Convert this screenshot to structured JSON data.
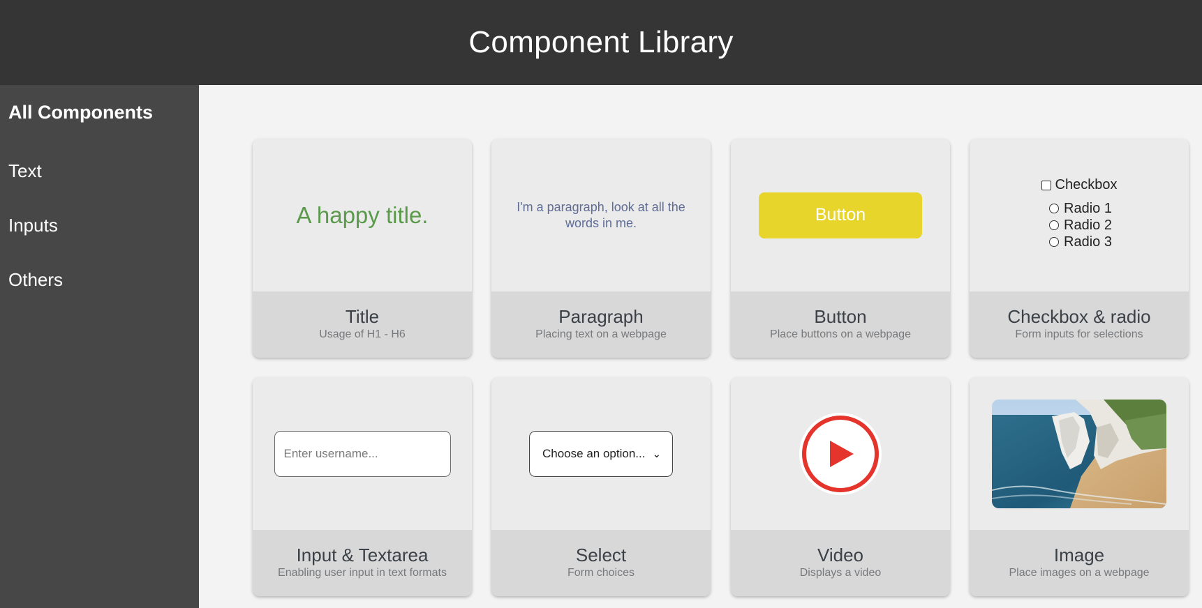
{
  "header": {
    "title": "Component Library"
  },
  "sidebar": {
    "heading": "All Components",
    "items": [
      {
        "label": "Text"
      },
      {
        "label": "Inputs"
      },
      {
        "label": "Others"
      }
    ]
  },
  "cards": [
    {
      "title": "Title",
      "desc": "Usage of H1 - H6",
      "preview": "A happy title."
    },
    {
      "title": "Paragraph",
      "desc": "Placing text on a webpage",
      "preview": "I'm a paragraph, look at all the words in me."
    },
    {
      "title": "Button",
      "desc": "Place buttons on a webpage",
      "preview": "Button"
    },
    {
      "title": "Checkbox & radio",
      "desc": "Form inputs for selections",
      "checkbox": "Checkbox",
      "radios": [
        "Radio 1",
        "Radio 2",
        "Radio 3"
      ]
    },
    {
      "title": "Input & Textarea",
      "desc": "Enabling user input in text formats",
      "placeholder": "Enter username..."
    },
    {
      "title": "Select",
      "desc": "Form choices",
      "selected": "Choose an option..."
    },
    {
      "title": "Video",
      "desc": "Displays a video",
      "icon": "play-icon"
    },
    {
      "title": "Image",
      "desc": "Place images on a webpage"
    }
  ],
  "colors": {
    "header_bg": "#353535",
    "sidebar_bg": "#474747",
    "title_green": "#5a9a4a",
    "button_yellow": "#e8d52c",
    "play_red": "#e4342b"
  }
}
